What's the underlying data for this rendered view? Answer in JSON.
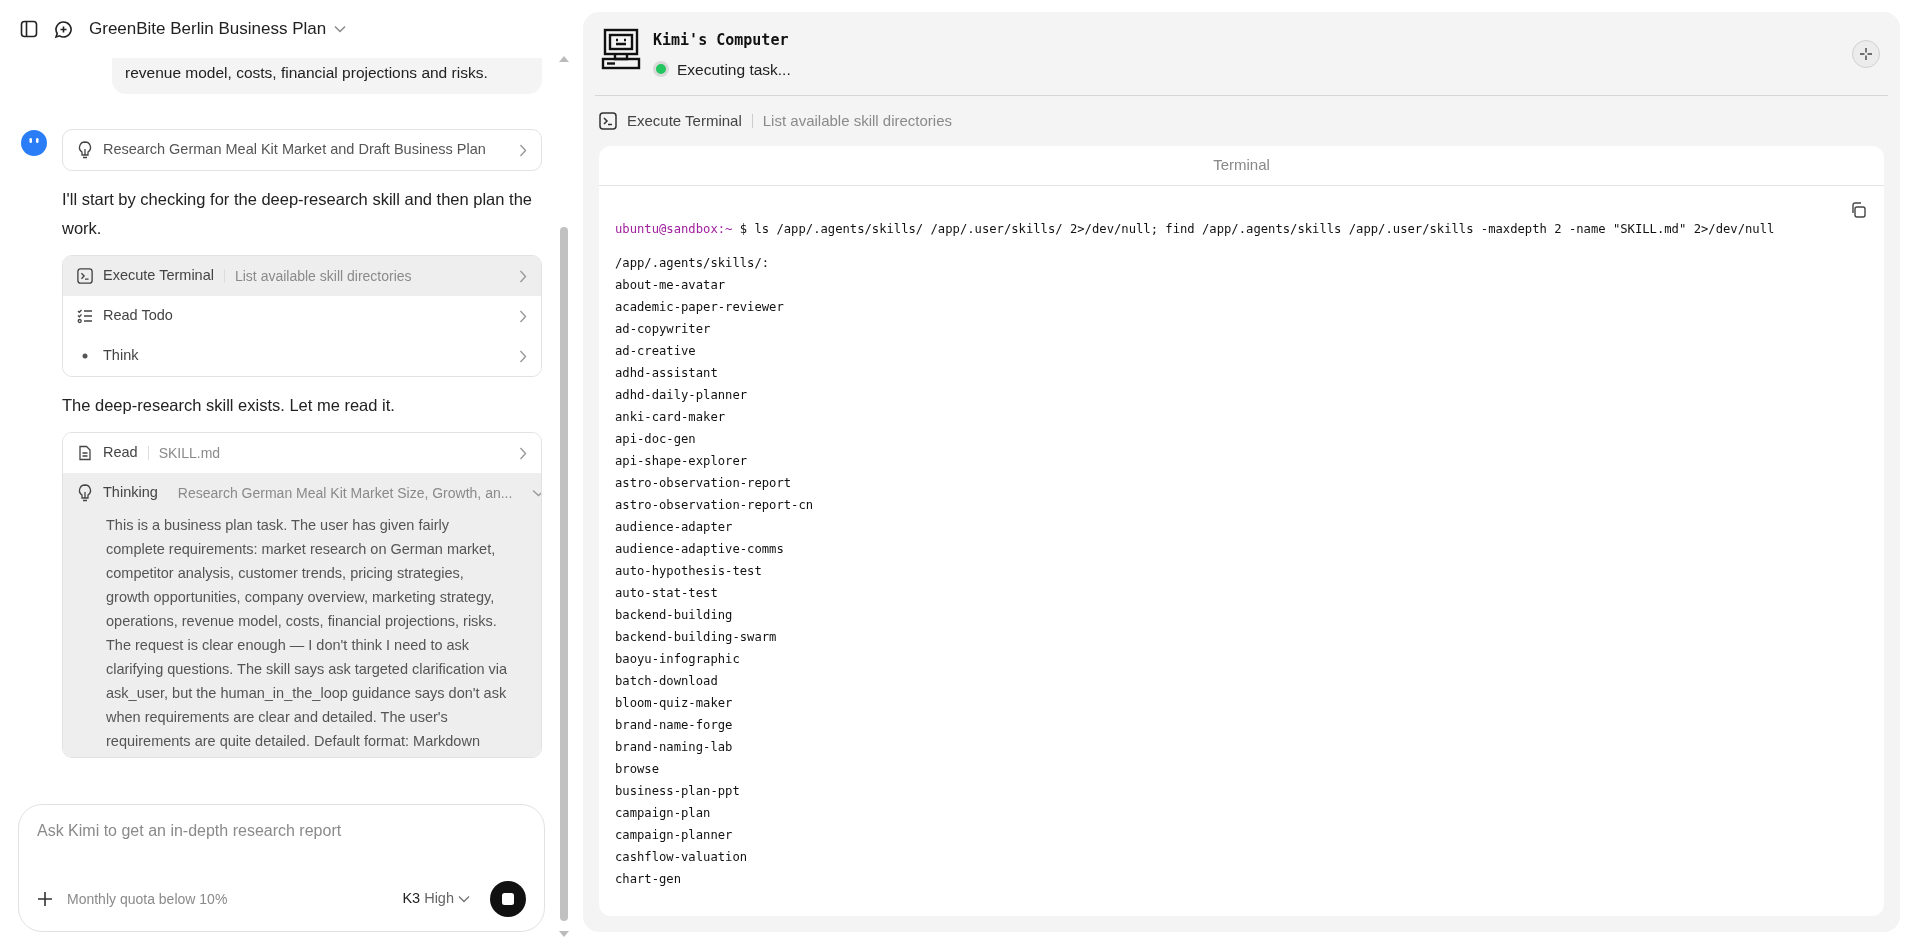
{
  "header": {
    "title": "GreenBite Berlin Business Plan"
  },
  "user_message": "revenue model, costs, financial projections and risks.",
  "assistant": {
    "task_card": "Research German Meal Kit Market and Draft Business Plan",
    "blocks": [
      {
        "kind": "text",
        "text": "I'll start by checking for the deep-research skill and then plan the work."
      },
      {
        "kind": "steps",
        "steps": [
          {
            "kind": "terminal",
            "label": "Execute Terminal",
            "detail": "List available skill directories",
            "highlighted": true,
            "expanded": false
          },
          {
            "kind": "todo",
            "label": "Read Todo",
            "highlighted": false,
            "expanded": false
          },
          {
            "kind": "dot",
            "label": "Think",
            "highlighted": false,
            "expanded": false
          }
        ]
      },
      {
        "kind": "text",
        "text": "The deep-research skill exists. Let me read it."
      },
      {
        "kind": "steps",
        "steps": [
          {
            "kind": "read",
            "label": "Read",
            "detail": "SKILL.md",
            "highlighted": false,
            "expanded": false
          },
          {
            "kind": "thinking",
            "label": "Thinking",
            "detail": "Research German Meal Kit Market Size, Growth, an...",
            "highlighted": true,
            "expanded": true,
            "body": "This is a business plan task. The user has given fairly complete requirements: market research on German market, competitor analysis, customer trends, pricing strategies, growth opportunities, company overview, marketing strategy, operations, revenue model, costs, financial projections, risks. The request is clear enough — I don't think I need to ask clarifying questions. The skill says ask targeted clarification via ask_user, but the human_in_the_loop guidance says don't ask when requirements are clear and detailed. The user's requirements are quite detailed. Default format: Markdown"
          }
        ]
      }
    ]
  },
  "composer": {
    "placeholder": "Ask Kimi to get an in-depth research report",
    "quota": "Monthly quota below 10%",
    "model": "K3",
    "mode": "High"
  },
  "computer": {
    "title": "Kimi's Computer",
    "status": "Executing task...",
    "running": true,
    "tool": {
      "label": "Execute Terminal",
      "detail": "List available skill directories"
    },
    "terminal": {
      "title": "Terminal",
      "prompt": "ubuntu@sandbox:~",
      "symbol": "$",
      "command": "ls /app/.agents/skills/ /app/.user/skills/ 2>/dev/null; find /app/.agents/skills /app/.user/skills -maxdepth 2 -name \"SKILL.md\" 2>/dev/null",
      "output": [
        "/app/.agents/skills/:",
        "about-me-avatar",
        "academic-paper-reviewer",
        "ad-copywriter",
        "ad-creative",
        "adhd-assistant",
        "adhd-daily-planner",
        "anki-card-maker",
        "api-doc-gen",
        "api-shape-explorer",
        "astro-observation-report",
        "astro-observation-report-cn",
        "audience-adapter",
        "audience-adaptive-comms",
        "auto-hypothesis-test",
        "auto-stat-test",
        "backend-building",
        "backend-building-swarm",
        "baoyu-infographic",
        "batch-download",
        "bloom-quiz-maker",
        "brand-name-forge",
        "brand-naming-lab",
        "browse",
        "business-plan-ppt",
        "campaign-plan",
        "campaign-planner",
        "cashflow-valuation",
        "chart-gen"
      ]
    }
  }
}
